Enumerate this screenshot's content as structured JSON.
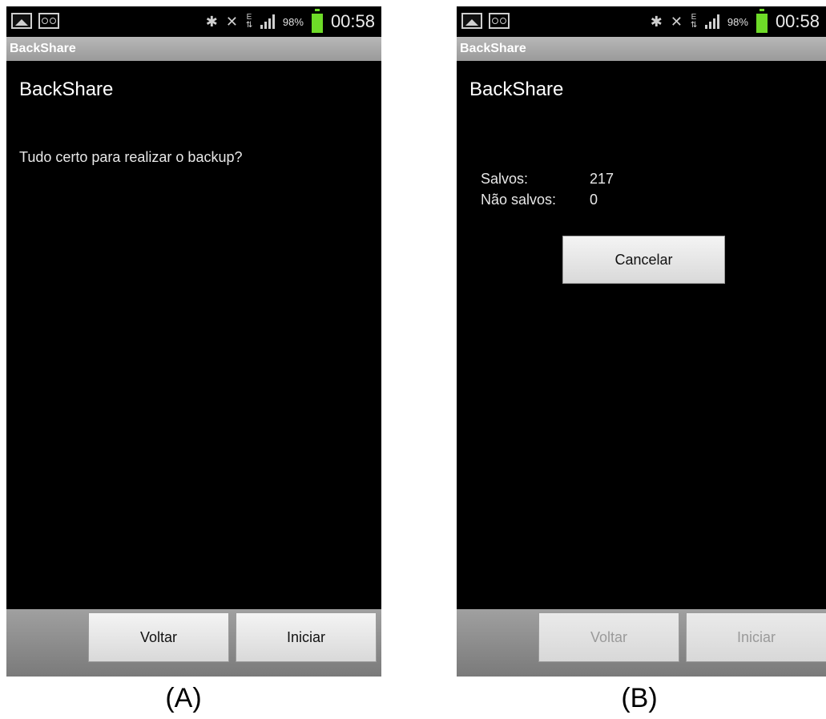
{
  "screens": [
    {
      "status_bar": {
        "battery_pct": "98%",
        "time": "00:58"
      },
      "title_bar": "BackShare",
      "heading": "BackShare",
      "message": "Tudo certo para realizar o backup?",
      "buttons": {
        "back": "Voltar",
        "start": "Iniciar"
      },
      "caption": "(A)"
    },
    {
      "status_bar": {
        "battery_pct": "98%",
        "time": "00:58"
      },
      "title_bar": "BackShare",
      "heading": "BackShare",
      "stats": [
        {
          "label": "Salvos:",
          "value": "217"
        },
        {
          "label": "Não salvos:",
          "value": "0"
        }
      ],
      "cancel_button": "Cancelar",
      "buttons": {
        "back": "Voltar",
        "start": "Iniciar"
      },
      "caption": "(B)"
    }
  ],
  "icons": [
    "gallery-icon",
    "voicemail-icon",
    "bluetooth-icon",
    "mute-icon",
    "edge-data-icon",
    "signal-icon",
    "battery-icon"
  ],
  "colors": {
    "battery": "#6edb28",
    "screen_bg": "#000000"
  }
}
